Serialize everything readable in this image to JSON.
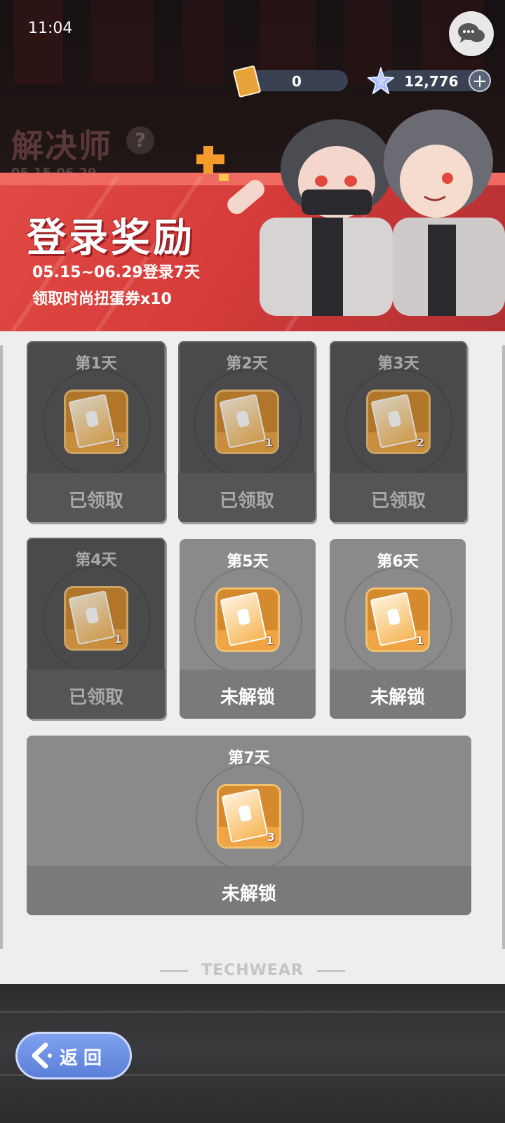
{
  "status": {
    "time": "11:04"
  },
  "currency": {
    "tickets": "0",
    "gems": "12,776",
    "plus": "+"
  },
  "event": {
    "title": "解决师",
    "date": "05.15-06.29",
    "help": "?"
  },
  "banner": {
    "title": "登录奖励",
    "line1": "05.15~06.29登录7天",
    "line2": "领取时尚扭蛋券x10"
  },
  "rewards": [
    {
      "day": "第1天",
      "qty": "1",
      "status": "已领取",
      "claimed": true
    },
    {
      "day": "第2天",
      "qty": "1",
      "status": "已领取",
      "claimed": true
    },
    {
      "day": "第3天",
      "qty": "2",
      "status": "已领取",
      "claimed": true
    },
    {
      "day": "第4天",
      "qty": "1",
      "status": "已领取",
      "claimed": true
    },
    {
      "day": "第5天",
      "qty": "1",
      "status": "未解锁",
      "claimed": false
    },
    {
      "day": "第6天",
      "qty": "1",
      "status": "未解锁",
      "claimed": false
    },
    {
      "day": "第7天",
      "qty": "3",
      "status": "未解锁",
      "claimed": false
    }
  ],
  "footer": {
    "brand": "TECHWEAR",
    "back_label": "返回"
  },
  "icons": {
    "chat": "chat-bubbles-icon",
    "ticket": "fashion-ticket-icon",
    "gem": "star-crystal-icon",
    "back": "back-arrow-icon",
    "help": "help-icon"
  },
  "colors": {
    "banner": "#d63c3a",
    "accent_gold": "#e7a23a",
    "back_button": "#6b8fe3",
    "panel": "#eeeeee"
  }
}
